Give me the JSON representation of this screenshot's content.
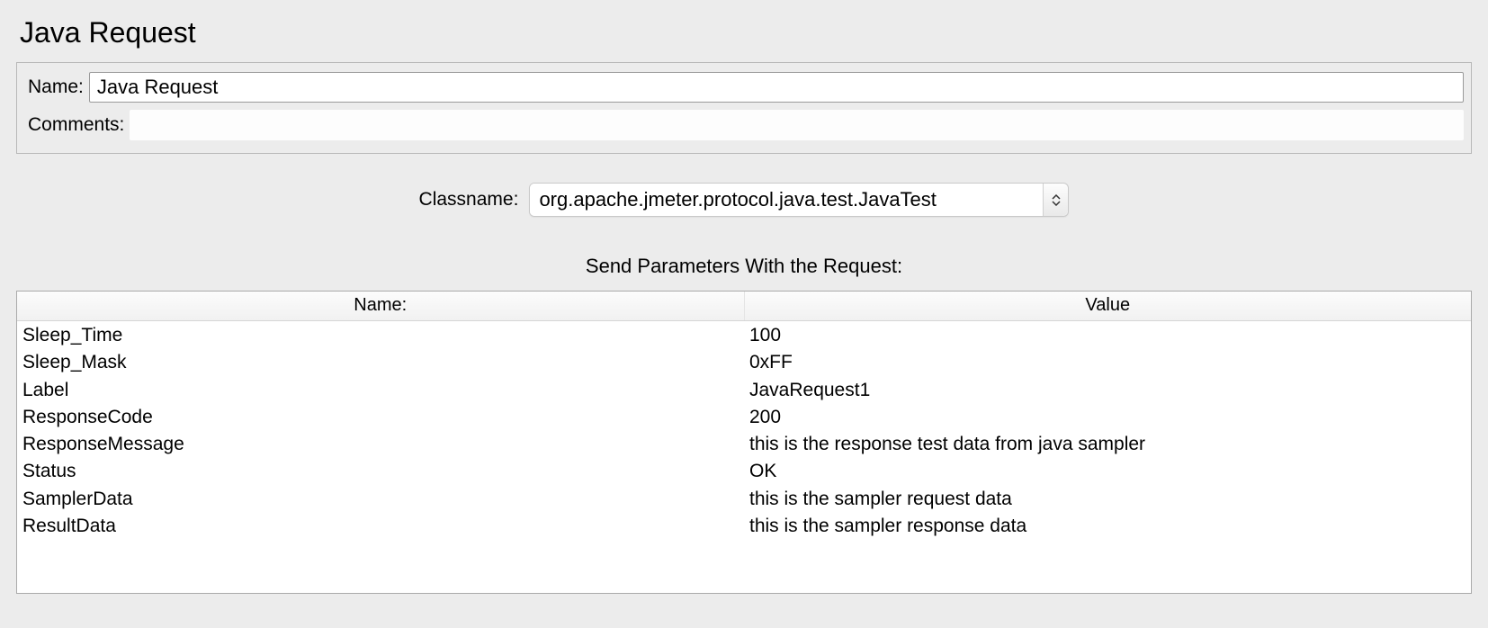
{
  "panel": {
    "title": "Java Request"
  },
  "form": {
    "name_label": "Name:",
    "name_value": "Java Request",
    "comments_label": "Comments:",
    "comments_value": ""
  },
  "classname": {
    "label": "Classname:",
    "value": "org.apache.jmeter.protocol.java.test.JavaTest"
  },
  "params": {
    "heading": "Send Parameters With the Request:",
    "columns": {
      "name": "Name:",
      "value": "Value"
    },
    "rows": [
      {
        "name": "Sleep_Time",
        "value": "100"
      },
      {
        "name": "Sleep_Mask",
        "value": "0xFF"
      },
      {
        "name": "Label",
        "value": "JavaRequest1"
      },
      {
        "name": "ResponseCode",
        "value": "200"
      },
      {
        "name": "ResponseMessage",
        "value": "this is the response test data from java sampler"
      },
      {
        "name": "Status",
        "value": "OK"
      },
      {
        "name": "SamplerData",
        "value": "this is the sampler  request data"
      },
      {
        "name": "ResultData",
        "value": "this is the sampler response data"
      }
    ]
  }
}
